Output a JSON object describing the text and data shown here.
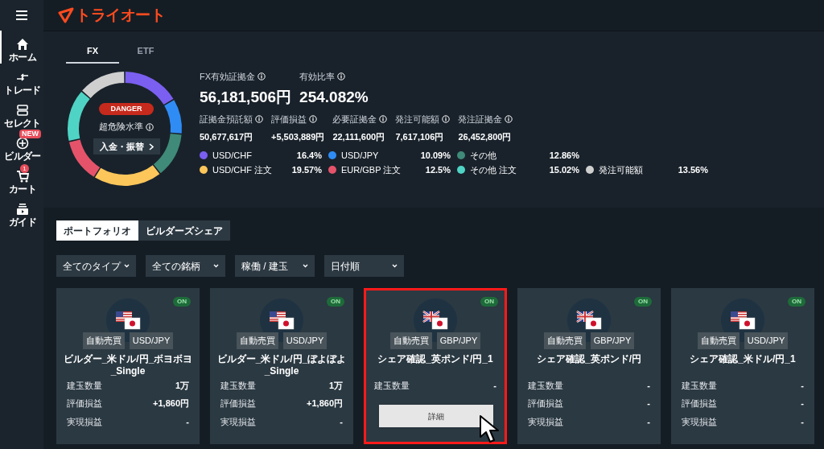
{
  "header": {
    "logo": "トライオート"
  },
  "sidebar": {
    "items": [
      {
        "label": "ホーム",
        "selected": true
      },
      {
        "label": "トレード",
        "selected": false
      },
      {
        "label": "セレクト",
        "selected": false
      },
      {
        "label": "ビルダー",
        "selected": false,
        "badge": "NEW"
      },
      {
        "label": "カート",
        "selected": false,
        "count": "1"
      },
      {
        "label": "ガイド",
        "selected": false
      }
    ]
  },
  "asset_tabs": [
    {
      "label": "FX",
      "selected": true
    },
    {
      "label": "ETF",
      "selected": false
    }
  ],
  "risk": {
    "badge": "DANGER",
    "status": "超危険水準",
    "deposit_button": "入金・振替"
  },
  "portfolio_chart": {
    "chart_data": {
      "type": "donut",
      "categories": [
        "USD/CHF",
        "USD/JPY",
        "その他",
        "USD/CHF 注文",
        "EUR/GBP 注文",
        "その他 注文",
        "発注可能額"
      ],
      "values": [
        16.4,
        10.09,
        12.86,
        19.57,
        12.5,
        15.02,
        13.56
      ]
    }
  },
  "summary": [
    {
      "label": "FX有効証拠金",
      "value": "56,181,506円"
    },
    {
      "label": "有効比率",
      "value": "254.082%"
    }
  ],
  "details": [
    {
      "label": "証拠金預託額",
      "value": "50,677,617円"
    },
    {
      "label": "評価損益",
      "value": "+5,503,889円"
    },
    {
      "label": "必要証拠金",
      "value": "22,111,600円"
    },
    {
      "label": "発注可能額",
      "value": "7,617,106円"
    },
    {
      "label": "発注証拠金",
      "value": "26,452,800円"
    }
  ],
  "legend_rows": [
    [
      {
        "value": "16.4%",
        "color": "#7b5ff0"
      },
      {
        "value": "10.09%",
        "color": "#2f8cf5"
      },
      {
        "value": "12.86%",
        "color": "#3f8a78"
      }
    ],
    [
      {
        "value": "19.57%",
        "color": "#fcc65a"
      },
      {
        "value": "12.5%",
        "color": "#e5536a"
      },
      {
        "value": "15.02%",
        "color": "#4fd3c4"
      },
      {
        "value": "13.56%",
        "color": "#cfcfcf"
      }
    ]
  ],
  "section_tabs": [
    {
      "label": "ポートフォリオ",
      "selected": true
    },
    {
      "label": "ビルダーズシェア",
      "selected": false
    }
  ],
  "filters": [
    "全てのタイプ",
    "全ての銘柄",
    "稼働 / 建玉",
    "日付順"
  ],
  "cards": [
    {
      "status": "ON",
      "kind": "usd",
      "type": "自動売買",
      "pair": "USD/JPY",
      "title": "ビルダー_米ドル/円_ボヨボヨ_Single",
      "highlighted": false,
      "rows": [
        {
          "label": "建玉数量",
          "value": "1万"
        },
        {
          "label": "評価損益",
          "value": "+1,860円"
        },
        {
          "label": "実現損益",
          "value": "-"
        }
      ]
    },
    {
      "status": "ON",
      "kind": "usd",
      "type": "自動売買",
      "pair": "USD/JPY",
      "title": "ビルダー_米ドル/円_ぼよぼよ_Single",
      "highlighted": false,
      "rows": [
        {
          "label": "建玉数量",
          "value": "1万"
        },
        {
          "label": "評価損益",
          "value": "+1,860円"
        },
        {
          "label": "実現損益",
          "value": "-"
        }
      ]
    },
    {
      "status": "ON",
      "kind": "gbp",
      "type": "自動売買",
      "pair": "GBP/JPY",
      "title": "シェア確認_英ポンド/円_1",
      "highlighted": true,
      "detail_button": "詳細",
      "rows": [
        {
          "label": "建玉数量",
          "value": "-"
        }
      ]
    },
    {
      "status": "ON",
      "kind": "gbp",
      "type": "自動売買",
      "pair": "GBP/JPY",
      "title": "シェア確認_英ポンド/円",
      "highlighted": false,
      "rows": [
        {
          "label": "建玉数量",
          "value": "-"
        },
        {
          "label": "評価損益",
          "value": "-"
        },
        {
          "label": "実現損益",
          "value": "-"
        }
      ]
    },
    {
      "status": "ON",
      "kind": "usd",
      "type": "自動売買",
      "pair": "USD/JPY",
      "title": "シェア確認_米ドル/円_1",
      "highlighted": false,
      "rows": [
        {
          "label": "建玉数量",
          "value": "-"
        },
        {
          "label": "評価損益",
          "value": "-"
        },
        {
          "label": "実現損益",
          "value": "-"
        }
      ]
    }
  ]
}
